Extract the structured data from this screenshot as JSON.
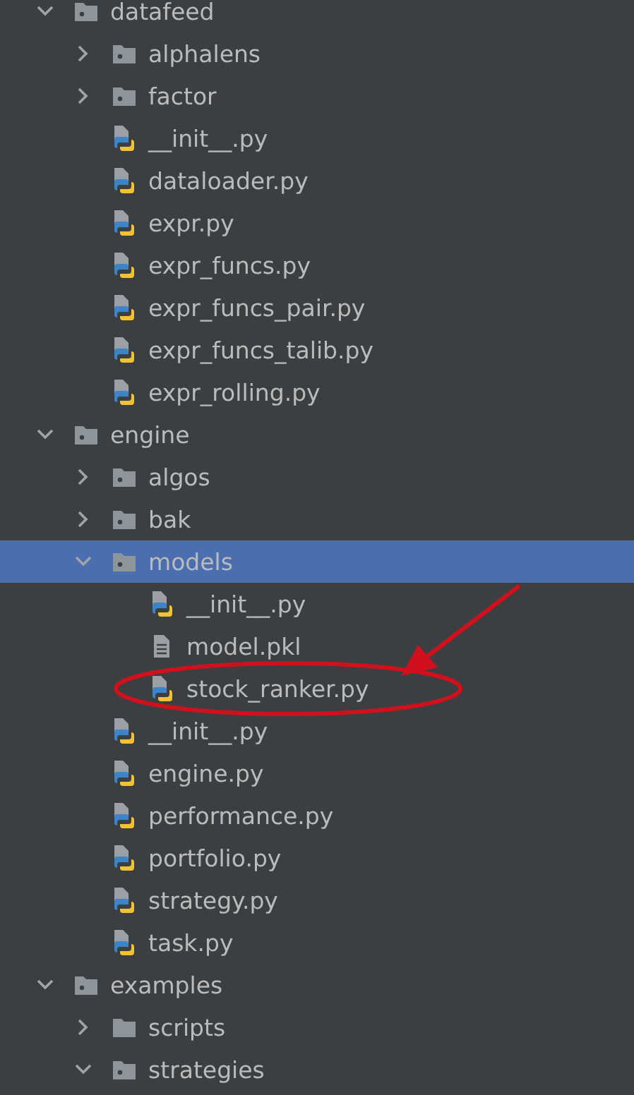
{
  "project_tree": {
    "items": [
      {
        "name": "datafeed",
        "kind": "package",
        "expanded": true,
        "selected": false,
        "circled": false,
        "children": [
          {
            "name": "alphalens",
            "kind": "package",
            "expanded": false,
            "selected": false,
            "circled": false
          },
          {
            "name": "factor",
            "kind": "package",
            "expanded": false,
            "selected": false,
            "circled": false
          },
          {
            "name": "__init__.py",
            "kind": "python",
            "selected": false,
            "circled": false
          },
          {
            "name": "dataloader.py",
            "kind": "python",
            "selected": false,
            "circled": false
          },
          {
            "name": "expr.py",
            "kind": "python",
            "selected": false,
            "circled": false
          },
          {
            "name": "expr_funcs.py",
            "kind": "python",
            "selected": false,
            "circled": false
          },
          {
            "name": "expr_funcs_pair.py",
            "kind": "python",
            "selected": false,
            "circled": false
          },
          {
            "name": "expr_funcs_talib.py",
            "kind": "python",
            "selected": false,
            "circled": false
          },
          {
            "name": "expr_rolling.py",
            "kind": "python",
            "selected": false,
            "circled": false
          }
        ]
      },
      {
        "name": "engine",
        "kind": "package",
        "expanded": true,
        "selected": false,
        "circled": false,
        "children": [
          {
            "name": "algos",
            "kind": "package",
            "expanded": false,
            "selected": false,
            "circled": false
          },
          {
            "name": "bak",
            "kind": "package",
            "expanded": false,
            "selected": false,
            "circled": false
          },
          {
            "name": "models",
            "kind": "package",
            "expanded": true,
            "selected": true,
            "circled": false,
            "children": [
              {
                "name": "__init__.py",
                "kind": "python",
                "selected": false,
                "circled": false
              },
              {
                "name": "model.pkl",
                "kind": "text",
                "selected": false,
                "circled": false
              },
              {
                "name": "stock_ranker.py",
                "kind": "python",
                "selected": false,
                "circled": true
              }
            ]
          },
          {
            "name": "__init__.py",
            "kind": "python",
            "selected": false,
            "circled": false
          },
          {
            "name": "engine.py",
            "kind": "python",
            "selected": false,
            "circled": false
          },
          {
            "name": "performance.py",
            "kind": "python",
            "selected": false,
            "circled": false
          },
          {
            "name": "portfolio.py",
            "kind": "python",
            "selected": false,
            "circled": false
          },
          {
            "name": "strategy.py",
            "kind": "python",
            "selected": false,
            "circled": false
          },
          {
            "name": "task.py",
            "kind": "python",
            "selected": false,
            "circled": false
          }
        ]
      },
      {
        "name": "examples",
        "kind": "package",
        "expanded": true,
        "selected": false,
        "circled": false,
        "children": [
          {
            "name": "scripts",
            "kind": "folder",
            "expanded": false,
            "selected": false,
            "circled": false
          },
          {
            "name": "strategies",
            "kind": "package",
            "expanded": true,
            "selected": false,
            "circled": false
          }
        ]
      }
    ]
  }
}
